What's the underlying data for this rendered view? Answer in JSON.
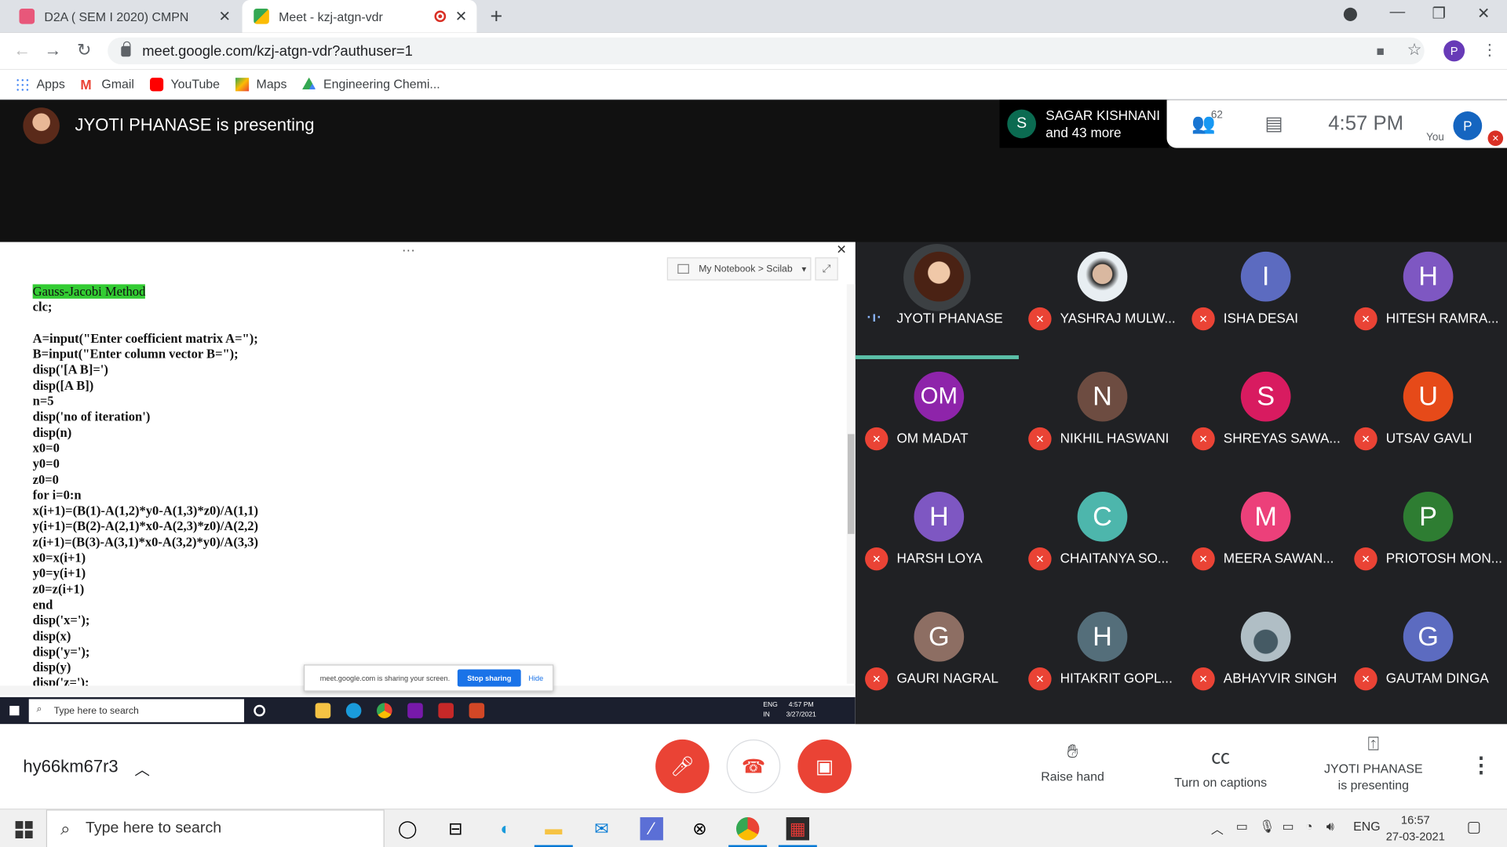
{
  "browser": {
    "tabs": [
      {
        "label": "D2A ( SEM I 2020) CMPN",
        "icon": "classroom-icon"
      },
      {
        "label": "Meet - kzj-atgn-vdr",
        "icon": "meet-icon"
      }
    ],
    "url": "meet.google.com/kzj-atgn-vdr?authuser=1",
    "profile_initial": "P",
    "bookmarks": [
      "Apps",
      "Gmail",
      "YouTube",
      "Maps",
      "Engineering Chemi..."
    ]
  },
  "meet": {
    "presenting_title": "JYOTI PHANASE is presenting",
    "speaker_initial": "S",
    "speaker_line1": "SAGAR KISHNANI",
    "speaker_line2": "and 43 more",
    "participant_count": "62",
    "time": "4:57 PM",
    "you_label": "You",
    "you_initial": "P",
    "meeting_code": "hy66km67r3",
    "raise_hand": "Raise hand",
    "captions": "Turn on captions",
    "presenting_line1": "JYOTI PHANASE",
    "presenting_line2": "is presenting"
  },
  "shared": {
    "notebook": "My Notebook > Scilab",
    "heading": "Gauss-Jacobi Method",
    "code": "clc;\n\nA=input(\"Enter coefficient matrix A=\");\nB=input(\"Enter column vector B=\");\ndisp('[A B]=')\ndisp([A B])\nn=5\ndisp('no of iteration')\ndisp(n)\nx0=0\ny0=0\nz0=0\nfor i=0:n\nx(i+1)=(B(1)-A(1,2)*y0-A(1,3)*z0)/A(1,1)\ny(i+1)=(B(2)-A(2,1)*x0-A(2,3)*z0)/A(2,2)\nz(i+1)=(B(3)-A(3,1)*x0-A(3,2)*y0)/A(3,3)\nx0=x(i+1)\ny0=y(i+1)\nz0=z(i+1)\nend\ndisp('x=');\ndisp(x)\ndisp('y=');\ndisp(y)\ndisp('z=');",
    "share_notice": "meet.google.com is sharing your screen.",
    "stop_sharing": "Stop sharing",
    "hide": "Hide",
    "mini_search": "Type here to search",
    "mini_lang1": "ENG",
    "mini_lang2": "IN",
    "mini_time": "4:57 PM",
    "mini_date": "3/27/2021"
  },
  "participants": [
    {
      "initial": "",
      "name": "JYOTI PHANASE",
      "color": "#3c4043",
      "photo": true,
      "speaking": true
    },
    {
      "initial": "",
      "name": "YASHRAJ MULW...",
      "color": "#b0bec5",
      "photo": true
    },
    {
      "initial": "I",
      "name": "ISHA DESAI",
      "color": "#5c6bc0"
    },
    {
      "initial": "H",
      "name": "HITESH RAMRA...",
      "color": "#7e57c2"
    },
    {
      "initial": "OM",
      "name": "OM MADAT",
      "color": "#8e24aa"
    },
    {
      "initial": "N",
      "name": "NIKHIL HASWANI",
      "color": "#6d4c41"
    },
    {
      "initial": "S",
      "name": "SHREYAS SAWA...",
      "color": "#d81b60"
    },
    {
      "initial": "U",
      "name": "UTSAV GAVLI",
      "color": "#e64a19"
    },
    {
      "initial": "H",
      "name": "HARSH LOYA",
      "color": "#7e57c2"
    },
    {
      "initial": "C",
      "name": "CHAITANYA SO...",
      "color": "#4db6ac"
    },
    {
      "initial": "M",
      "name": "MEERA SAWAN...",
      "color": "#ec407a"
    },
    {
      "initial": "P",
      "name": "PRIOTOSH MON...",
      "color": "#2e7d32"
    },
    {
      "initial": "G",
      "name": "GAURI NAGRAL",
      "color": "#8d6e63"
    },
    {
      "initial": "H",
      "name": "HITAKRIT GOPL...",
      "color": "#546e7a"
    },
    {
      "initial": "",
      "name": "ABHAYVIR SINGH",
      "color": "#37474f",
      "photo": true
    },
    {
      "initial": "G",
      "name": "GAUTAM DINGA",
      "color": "#5c6bc0"
    }
  ],
  "taskbar": {
    "search": "Type here to search",
    "lang": "ENG",
    "time": "16:57",
    "date": "27-03-2021"
  }
}
